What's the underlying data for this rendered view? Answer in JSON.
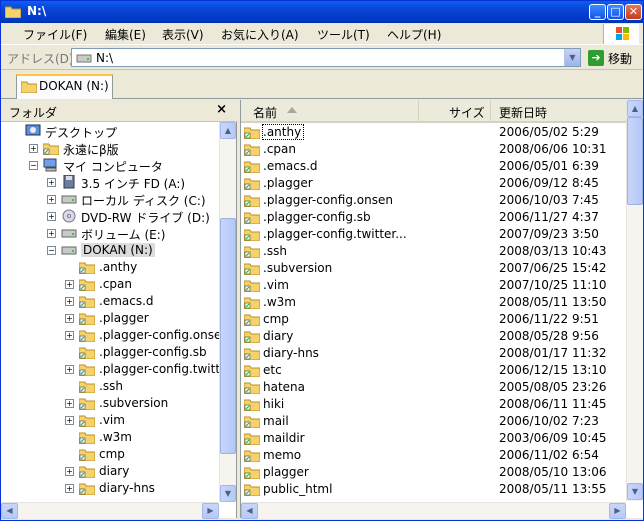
{
  "window": {
    "title": "N:\\"
  },
  "menu": [
    {
      "label": "ファイル(F)"
    },
    {
      "label": "編集(E)"
    },
    {
      "label": "表示(V)"
    },
    {
      "label": "お気に入り(A)"
    },
    {
      "label": "ツール(T)"
    },
    {
      "label": "ヘルプ(H)"
    }
  ],
  "address": {
    "label": "アドレス(D)",
    "value": "N:\\",
    "go_label": "移動"
  },
  "tab": {
    "label": "DOKAN (N:)"
  },
  "folder_pane": {
    "title": "フォルダ",
    "close": "×"
  },
  "tree": [
    {
      "label": "デスクトップ",
      "exp": "",
      "icon": "desktop-icon"
    },
    {
      "label": "永遠にβ版",
      "exp": "+",
      "icon": "folder-icon"
    },
    {
      "label": "マイ コンピュータ",
      "exp": "−",
      "icon": "computer-icon"
    },
    {
      "label": "3.5 インチ FD (A:)",
      "exp": "+",
      "icon": "floppy-icon"
    },
    {
      "label": "ローカル ディスク (C:)",
      "exp": "+",
      "icon": "drive-icon"
    },
    {
      "label": "DVD-RW ドライブ (D:)",
      "exp": "+",
      "icon": "dvd-icon"
    },
    {
      "label": "ボリューム (E:)",
      "exp": "+",
      "icon": "drive-icon"
    },
    {
      "label": "DOKAN (N:)",
      "exp": "−",
      "icon": "drive-icon"
    },
    {
      "label": ".anthy",
      "exp": "",
      "icon": "folder-icon"
    },
    {
      "label": ".cpan",
      "exp": "+",
      "icon": "folder-icon"
    },
    {
      "label": ".emacs.d",
      "exp": "+",
      "icon": "folder-icon"
    },
    {
      "label": ".plagger",
      "exp": "+",
      "icon": "folder-icon"
    },
    {
      "label": ".plagger-config.onsen",
      "exp": "+",
      "icon": "folder-icon"
    },
    {
      "label": ".plagger-config.sb",
      "exp": "",
      "icon": "folder-icon"
    },
    {
      "label": ".plagger-config.twitter",
      "exp": "+",
      "icon": "folder-icon"
    },
    {
      "label": ".ssh",
      "exp": "",
      "icon": "folder-icon"
    },
    {
      "label": ".subversion",
      "exp": "+",
      "icon": "folder-icon"
    },
    {
      "label": ".vim",
      "exp": "+",
      "icon": "folder-icon"
    },
    {
      "label": ".w3m",
      "exp": "",
      "icon": "folder-icon"
    },
    {
      "label": "cmp",
      "exp": "",
      "icon": "folder-icon"
    },
    {
      "label": "diary",
      "exp": "+",
      "icon": "folder-icon"
    },
    {
      "label": "diary-hns",
      "exp": "+",
      "icon": "folder-icon"
    }
  ],
  "columns": {
    "name": "名前",
    "size": "サイズ",
    "date": "更新日時"
  },
  "files": [
    {
      "name": ".anthy",
      "date": "2006/05/02 5:29"
    },
    {
      "name": ".cpan",
      "date": "2008/06/06 10:31"
    },
    {
      "name": ".emacs.d",
      "date": "2006/05/01 6:39"
    },
    {
      "name": ".plagger",
      "date": "2006/09/12 8:45"
    },
    {
      "name": ".plagger-config.onsen",
      "date": "2006/10/03 7:45"
    },
    {
      "name": ".plagger-config.sb",
      "date": "2006/11/27 4:37"
    },
    {
      "name": ".plagger-config.twitter...",
      "date": "2007/09/23 3:50"
    },
    {
      "name": ".ssh",
      "date": "2008/03/13 10:43"
    },
    {
      "name": ".subversion",
      "date": "2007/06/25 15:42"
    },
    {
      "name": ".vim",
      "date": "2007/10/25 11:10"
    },
    {
      "name": ".w3m",
      "date": "2008/05/11 13:50"
    },
    {
      "name": "cmp",
      "date": "2006/11/22 9:51"
    },
    {
      "name": "diary",
      "date": "2008/05/28 9:56"
    },
    {
      "name": "diary-hns",
      "date": "2008/01/17 11:32"
    },
    {
      "name": "etc",
      "date": "2006/12/15 13:10"
    },
    {
      "name": "hatena",
      "date": "2005/08/05 23:26"
    },
    {
      "name": "hiki",
      "date": "2008/06/11 11:45"
    },
    {
      "name": "mail",
      "date": "2006/10/02 7:23"
    },
    {
      "name": "maildir",
      "date": "2003/06/09 10:45"
    },
    {
      "name": "memo",
      "date": "2006/11/02 6:54"
    },
    {
      "name": "plagger",
      "date": "2008/05/10 13:06"
    },
    {
      "name": "public_html",
      "date": "2008/05/11 13:55"
    }
  ]
}
